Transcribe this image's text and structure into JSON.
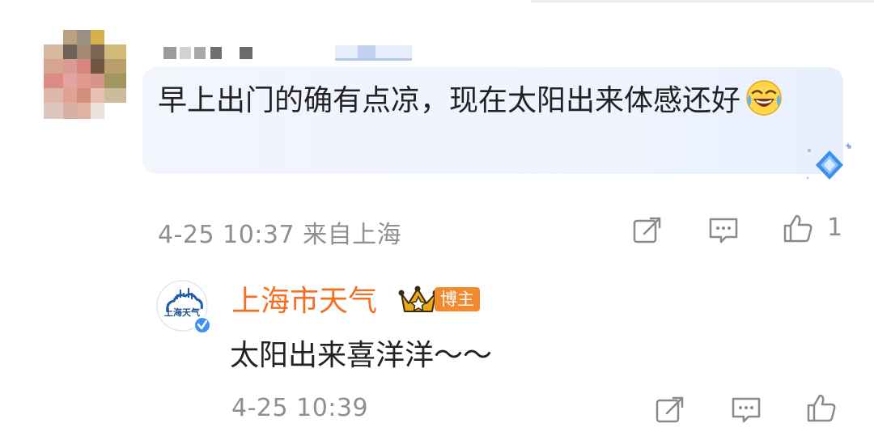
{
  "comment": {
    "text": "早上出门的确有点凉，现在太阳出来体感还好",
    "meta": "4-25 10:37 来自上海",
    "like_count": "1",
    "emoji_icon": "laugh-cry-emoji-icon"
  },
  "reply": {
    "author": "上海市天气",
    "badge": "博主",
    "avatar_text": "上海天气",
    "text": "太阳出来喜洋洋～～",
    "meta": "4-25 10:39"
  },
  "colors": {
    "accent": "#f36f22",
    "badge": "#f58a2c",
    "meta": "#8f8f8f",
    "bubble": "#f1f4fd"
  }
}
